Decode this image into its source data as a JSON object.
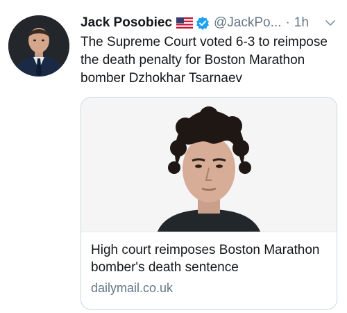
{
  "tweet": {
    "display_name": "Jack Posobiec",
    "flag_icon": "us-flag-icon",
    "verified_icon": "verified-badge-icon",
    "handle": "@JackPo...",
    "separator": "·",
    "time": "1h",
    "menu_icon": "chevron-down-icon",
    "text": "The Supreme Court voted 6-3 to reimpose the death penalty for Boston Marathon bomber Dzhokhar Tsarnaev"
  },
  "card": {
    "title": "High court reimposes Boston Marathon bomber's death sentence",
    "domain": "dailymail.co.uk"
  },
  "colors": {
    "text_primary": "#14171a",
    "text_secondary": "#657786",
    "verified_blue": "#1da1f2",
    "card_border": "#ccd6dd"
  }
}
